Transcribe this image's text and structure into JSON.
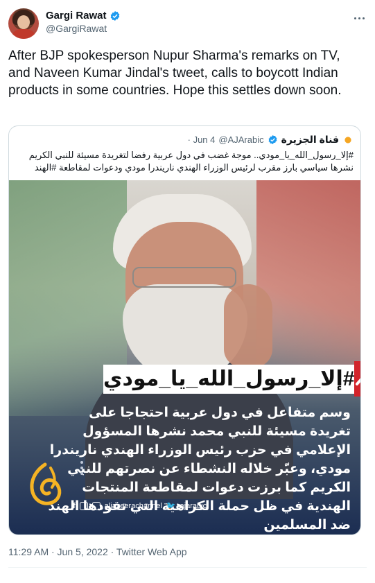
{
  "author": {
    "display_name": "Gargi Rawat",
    "handle": "@GargiRawat",
    "verified_icon": "verified-badge-icon",
    "accent": "#1d9bf0"
  },
  "tweet": {
    "text": "After BJP spokesperson Nupur Sharma's remarks on TV, and Naveen Kumar Jindal's tweet, calls to boycott Indian products in some countries. Hope this settles down soon.",
    "timestamp": "11:29 AM · Jun 5, 2022 · Twitter Web App"
  },
  "quoted": {
    "name": "قناة الجزيرة",
    "handle": "@AJArabic",
    "date": "· Jun 4",
    "text": "#إلا_رسول_الله_يا_مودي.. موجة غضب في دول عربية رفضا لتغريدة مسيئة للنبي الكريم نشرها سياسي بارز مقرب لرئيس الوزراء الهندي ناريندرا مودي ودعوات لمقاطعة #الهند",
    "image": {
      "hashtag": "#إلا_رسول_الله_يا_مودي",
      "body": "وسم متفاعل في دول عربية احتجاجا على تغريدة مسيئة للنبي محمد نشرها المسؤول الإعلامي في حزب رئيس الوزراء الهندي ناريندرا مودي، وعبّر خلاله النشطاء عن نصرتهم للنبي الكريم كما برزت دعوات لمقاطعة المنتجات الهندية في ظل حملة الكراهية التي تقودها الهند ضد المسلمين",
      "social_text": "aljazeerachannel",
      "social_text2": "ajarabic"
    }
  }
}
